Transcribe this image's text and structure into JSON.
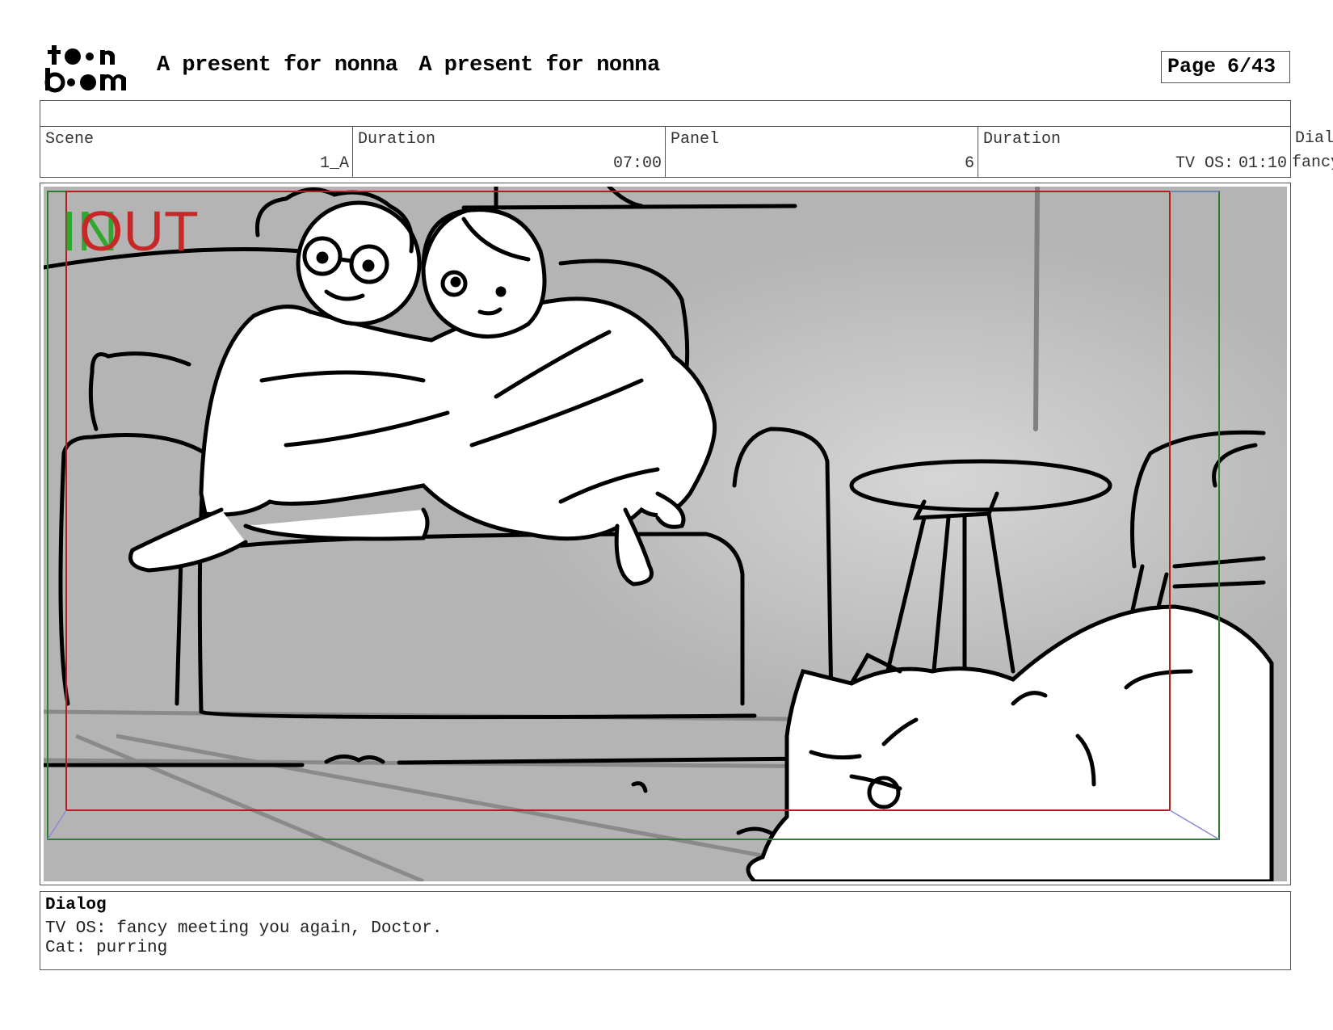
{
  "header": {
    "logo_text": "toon boom",
    "project_title": "A present for nonna",
    "sequence_title": "A present for nonna",
    "page_label": "Page",
    "page_value": "6/43"
  },
  "info": {
    "scene_label": "Scene",
    "scene_value": "1_A",
    "scene_duration_label": "Duration",
    "scene_duration_value": "07:00",
    "panel_label": "Panel",
    "panel_value": "6",
    "panel_duration_label": "Duration",
    "panel_duration_value": "01:10",
    "panel_duration_overlap": "TV OS:",
    "dialog_col_label": "Dial",
    "dialog_col_value": "fancy"
  },
  "panel": {
    "in_marker": "IN",
    "out_marker": "OUT",
    "colors": {
      "safe_frame": "#2e7d32",
      "action_frame": "#b71c1c",
      "in_color": "#2fa82f",
      "out_color": "#c62828",
      "background": "#b4b4b4"
    }
  },
  "dialog": {
    "heading": "Dialog",
    "lines": [
      "TV OS: fancy meeting you again, Doctor.",
      "Cat: purring"
    ]
  }
}
